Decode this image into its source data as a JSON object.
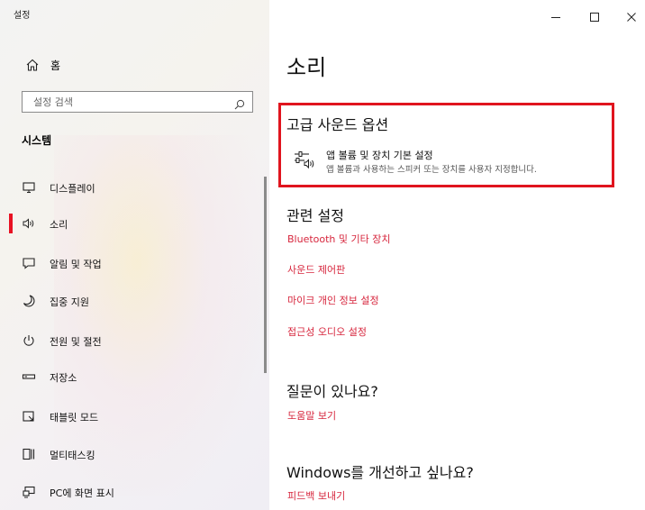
{
  "window": {
    "title": "설정",
    "controls": {
      "minimize": "–",
      "maximize": "□",
      "close": "✕"
    }
  },
  "sidebar": {
    "home_label": "홈",
    "search_placeholder": "설정 검색",
    "section_title": "시스템",
    "items": [
      {
        "label": "디스플레이",
        "icon": "display-icon"
      },
      {
        "label": "소리",
        "icon": "speaker-icon",
        "selected": true
      },
      {
        "label": "알림 및 작업",
        "icon": "notification-icon"
      },
      {
        "label": "집중 지원",
        "icon": "moon-icon"
      },
      {
        "label": "전원 및 절전",
        "icon": "power-icon"
      },
      {
        "label": "저장소",
        "icon": "storage-icon"
      },
      {
        "label": "태블릿 모드",
        "icon": "tablet-icon"
      },
      {
        "label": "멀티태스킹",
        "icon": "multitasking-icon"
      },
      {
        "label": "PC에 화면 표시",
        "icon": "project-icon"
      }
    ]
  },
  "main": {
    "title": "소리",
    "advanced": {
      "heading": "고급 사운드 옵션",
      "item_title": "앱 볼륨 및 장치 기본 설정",
      "item_desc": "앱 볼륨과 사용하는 스피커 또는 장치를 사용자 지정합니다."
    },
    "related": {
      "heading": "관련 설정",
      "links": [
        "Bluetooth 및 기타 장치",
        "사운드 제어판",
        "마이크 개인 정보 설정",
        "접근성 오디오 설정"
      ]
    },
    "question": {
      "heading": "질문이 있나요?",
      "link": "도움말 보기"
    },
    "improve": {
      "heading": "Windows를 개선하고 싶나요?",
      "link": "피드백 보내기"
    }
  },
  "colors": {
    "accent": "#e81123",
    "link": "#d7263d",
    "highlight": "#e0141e"
  }
}
